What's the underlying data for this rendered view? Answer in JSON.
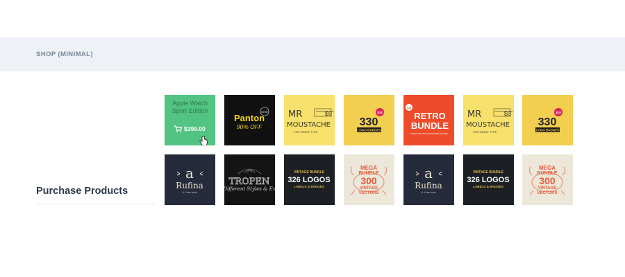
{
  "section": {
    "label": "SHOP (MINIMAL)"
  },
  "sidebar": {
    "title": "Purchase Products"
  },
  "products": [
    {
      "name": "apple-watch",
      "title_line1": "Apple Watch",
      "title_line2": "Sport Edition",
      "price": "$399.00",
      "state": "hover"
    },
    {
      "name": "panton",
      "title": "Panton",
      "subtitle": "90% OFF",
      "badge": "NEW"
    },
    {
      "name": "mr-moustache",
      "title_line1": "MR",
      "title_line2": "MOUSTACHE",
      "subtitle": "FOR GREAT TYPE",
      "price_tag": "$9",
      "tag_text": "HANDMADE FONT"
    },
    {
      "name": "330-logo-badges",
      "number": "330",
      "label": "LOGO BADGES",
      "price_tag": "$18"
    },
    {
      "name": "retro-bundle",
      "title_line1": "RETRO",
      "title_line2": "BUNDLE",
      "subtitle": "5 BEST SELLING PHOTOSHOP ACTIONS",
      "price_tag": "$18"
    },
    {
      "name": "mr-moustache-2",
      "title_line1": "MR",
      "title_line2": "MOUSTACHE",
      "subtitle": "FOR GREAT TYPE",
      "price_tag": "$9",
      "tag_text": "HANDMADE FONT"
    },
    {
      "name": "330-logo-badges-2",
      "number": "330",
      "label": "LOGO BADGES",
      "price_tag": "$18"
    },
    {
      "name": "rufina",
      "letter": "a",
      "title": "Rufina",
      "subtitle": "& 4 free fonts"
    },
    {
      "name": "tropen",
      "title": "TROPEN",
      "subtitle": "Different Styles & Ex"
    },
    {
      "name": "vintage-326",
      "line1": "VINTAGE BUNDLE",
      "line2": "326 LOGOS",
      "line3": "LABELS & BADGES"
    },
    {
      "name": "mega-bundle",
      "line1": "MEGA",
      "line2": "BUNDLE",
      "line3": "300",
      "line4": "VINTAGE",
      "line5": "VECTORS"
    },
    {
      "name": "rufina-2",
      "letter": "a",
      "title": "Rufina",
      "subtitle": "& 4 free fonts"
    },
    {
      "name": "vintage-326-2",
      "line1": "VINTAGE BUNDLE",
      "line2": "326 LOGOS",
      "line3": "LABELS & BADGES"
    },
    {
      "name": "mega-bundle-2",
      "line1": "MEGA",
      "line2": "BUNDLE",
      "line3": "300",
      "line4": "VINTAGE",
      "line5": "VECTORS"
    }
  ],
  "colors": {
    "section_bar": "#eef1f5",
    "hover_green": "#52c382",
    "panton_bg": "#111111",
    "panton_yellow": "#f4d51b",
    "moustache_bg": "#f7e16c",
    "badges_bg": "#f2cf4f",
    "retro_bg": "#ee4b2b",
    "rufina_bg": "#252b3b",
    "tropen_bg": "#141414",
    "vintage_bg": "#1c2024",
    "mega_bg": "#ece7d9",
    "mega_red": "#e35b3c"
  }
}
